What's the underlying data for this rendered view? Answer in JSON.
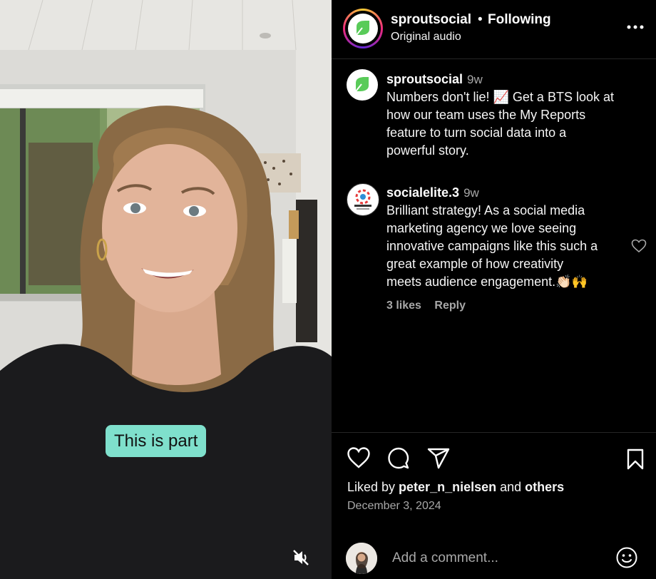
{
  "video": {
    "caption": "This is part",
    "mute_icon": "muted-speaker-icon"
  },
  "header": {
    "username": "sproutsocial",
    "separator": "•",
    "follow_status": "Following",
    "audio": "Original audio",
    "more_icon": "more-horizontal-icon"
  },
  "post": {
    "username": "sproutsocial",
    "time": "9w",
    "text_lines": [
      "Numbers don't lie! 📈 Get a BTS look at",
      "how our team uses the My Reports",
      "feature to turn social data into a",
      "powerful story."
    ]
  },
  "comment": {
    "username": "socialelite.3",
    "time": "9w",
    "text_lines": [
      "Brilliant strategy! As a social media",
      "marketing agency we love seeing",
      "innovative campaigns like this such a",
      "great example of how creativity",
      "meets audience engagement.👏🏻🙌"
    ],
    "likes": "3 likes",
    "reply": "Reply"
  },
  "actions": {
    "like_icon": "heart-icon",
    "comment_icon": "comment-bubble-icon",
    "share_icon": "paper-plane-icon",
    "save_icon": "bookmark-icon"
  },
  "likes_summary": {
    "prefix": "Liked by ",
    "user": "peter_n_nielsen",
    "middle": " and ",
    "others": "others"
  },
  "date": "December 3, 2024",
  "composer": {
    "placeholder": "Add a comment...",
    "emoji_icon": "smiley-icon"
  },
  "colors": {
    "caption_bg": "#7fe0cc",
    "sprout_green": "#59cb59",
    "muted_text": "#a8a8a8",
    "divider": "#262626"
  }
}
